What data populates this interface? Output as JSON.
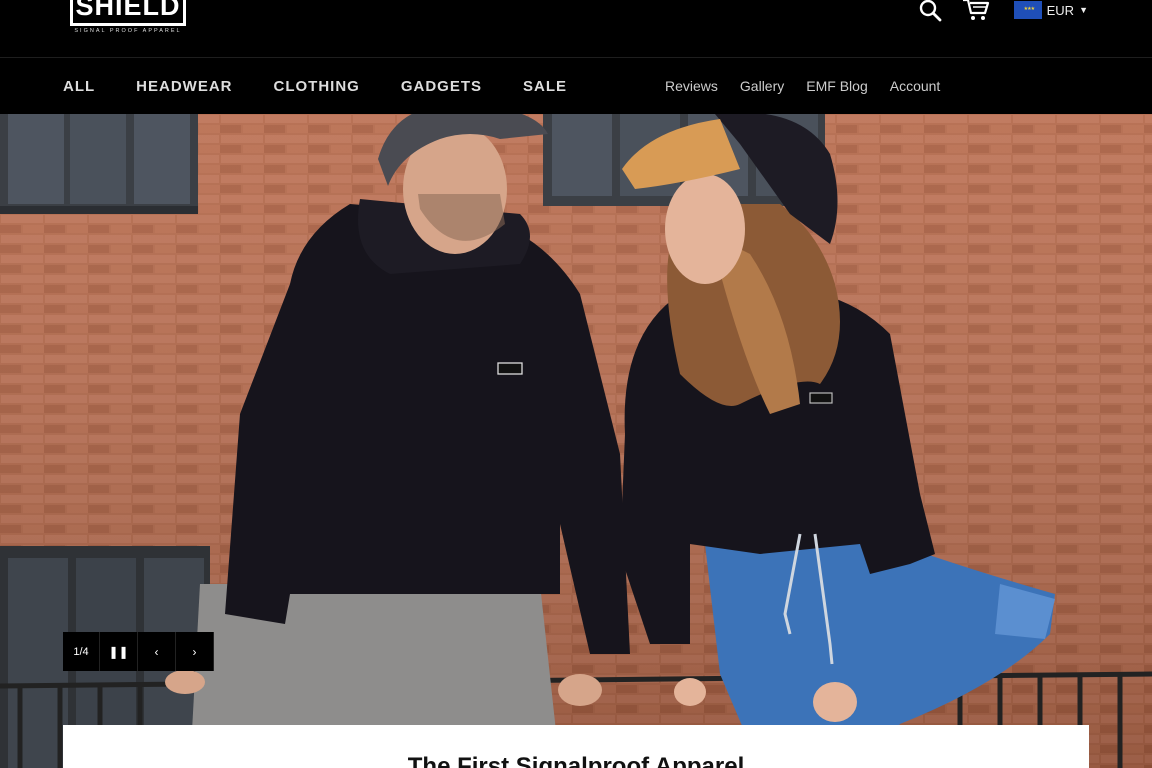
{
  "brand": {
    "name": "SHIELD",
    "tagline": "SIGNAL PROOF APPAREL"
  },
  "header": {
    "icons": [
      "search-icon",
      "cart-icon",
      "eu-flag-icon"
    ],
    "currency": "EUR"
  },
  "nav": {
    "main": [
      {
        "label": "ALL"
      },
      {
        "label": "HEADWEAR"
      },
      {
        "label": "CLOTHING"
      },
      {
        "label": "GADGETS"
      },
      {
        "label": "SALE"
      }
    ],
    "secondary": [
      {
        "label": "Reviews"
      },
      {
        "label": "Gallery"
      },
      {
        "label": "EMF Blog"
      },
      {
        "label": "Account"
      }
    ]
  },
  "slideshow": {
    "counter": "1/4",
    "pause_icon": "pause-icon",
    "prev_icon": "chevron-left-icon",
    "next_icon": "chevron-right-icon"
  },
  "hero": {
    "caption_title": "The First Signalproof Apparel"
  },
  "colors": {
    "header_bg": "#000000",
    "brick": "#b06a4c",
    "hoodie": "#15131c",
    "cap_tan": "#d89b55",
    "jeans": "#3c73b8"
  }
}
